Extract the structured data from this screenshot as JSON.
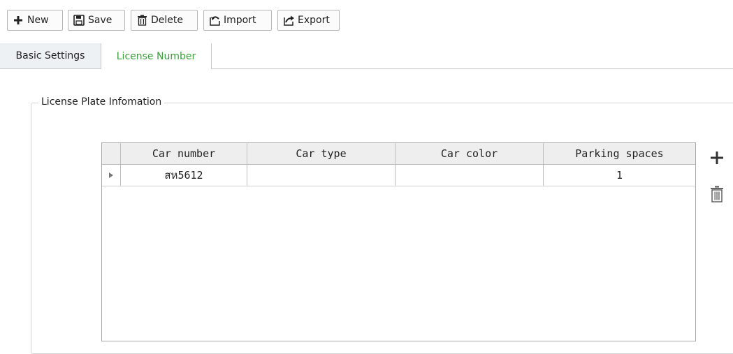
{
  "toolbar": {
    "new_label": "New",
    "save_label": "Save",
    "delete_label": "Delete",
    "import_label": "Import",
    "export_label": "Export"
  },
  "tabs": [
    {
      "label": "Basic Settings",
      "active": false
    },
    {
      "label": "License Number",
      "active": true
    }
  ],
  "section": {
    "title": "License Plate Infomation"
  },
  "grid": {
    "columns": [
      "Car number",
      "Car type",
      "Car color",
      "Parking spaces"
    ],
    "rows": [
      {
        "car_number": "สห5612",
        "car_type": "",
        "car_color": "",
        "parking_spaces": "1"
      }
    ]
  },
  "side_actions": {
    "add_icon": "plus-icon",
    "delete_icon": "trash-icon"
  },
  "colors": {
    "active_tab": "#3a9e3a",
    "border": "#b7b7b7"
  }
}
